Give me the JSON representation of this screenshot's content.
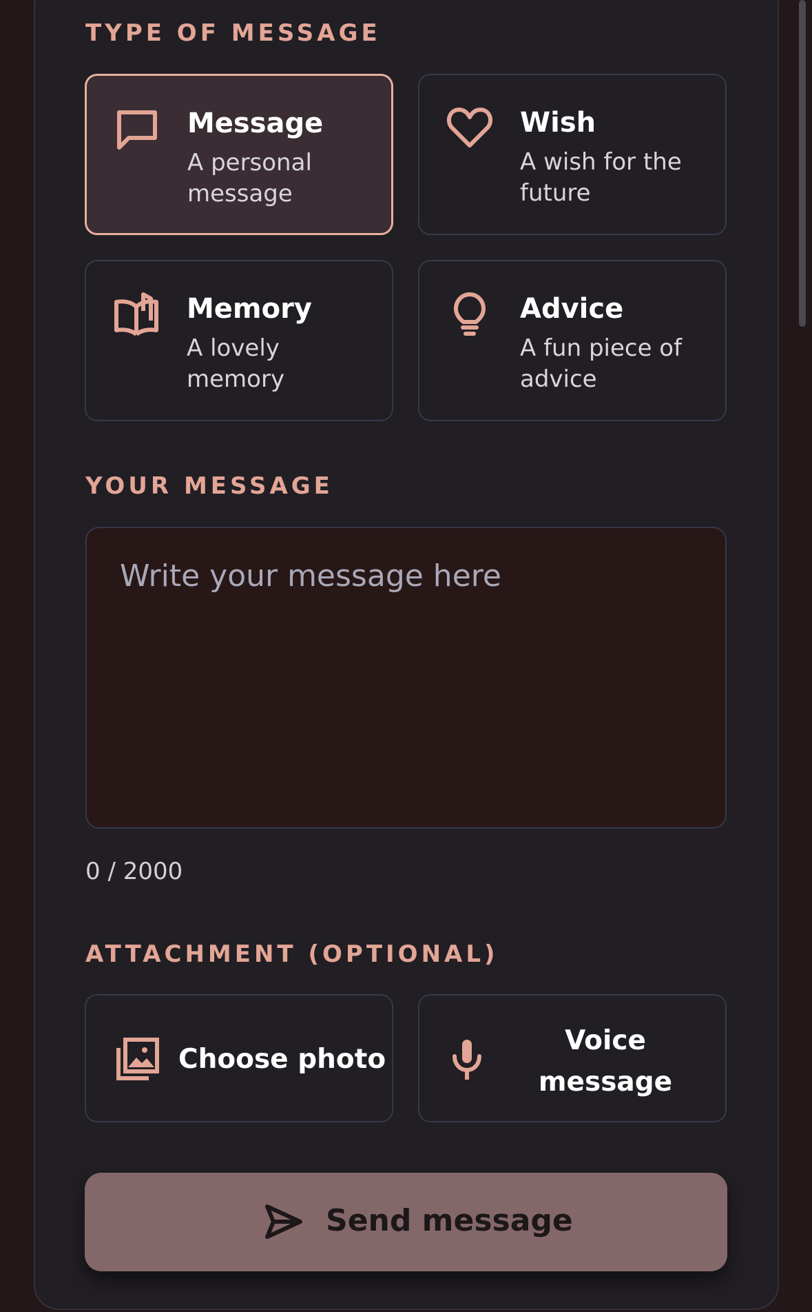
{
  "type_section": {
    "label": "TYPE OF MESSAGE",
    "options": [
      {
        "title": "Message",
        "description": "A personal message",
        "icon": "chat-bubble-icon",
        "selected": true
      },
      {
        "title": "Wish",
        "description": "A wish for the future",
        "icon": "heart-icon",
        "selected": false
      },
      {
        "title": "Memory",
        "description": "A lovely memory",
        "icon": "book-open-icon",
        "selected": false
      },
      {
        "title": "Advice",
        "description": "A fun piece of advice",
        "icon": "lightbulb-icon",
        "selected": false
      }
    ]
  },
  "message_section": {
    "label": "YOUR MESSAGE",
    "placeholder": "Write your message here",
    "value": "",
    "char_count": "0 / 2000"
  },
  "attachment_section": {
    "label": "ATTACHMENT (OPTIONAL)",
    "choose_photo_label": "Choose photo",
    "voice_message_label": "Voice message"
  },
  "send_button": {
    "label": "Send message"
  },
  "colors": {
    "accent": "#e3a595",
    "background": "#241719",
    "panel": "#211e24",
    "selected_card": "#3a2d34",
    "send_button": "#846869"
  }
}
